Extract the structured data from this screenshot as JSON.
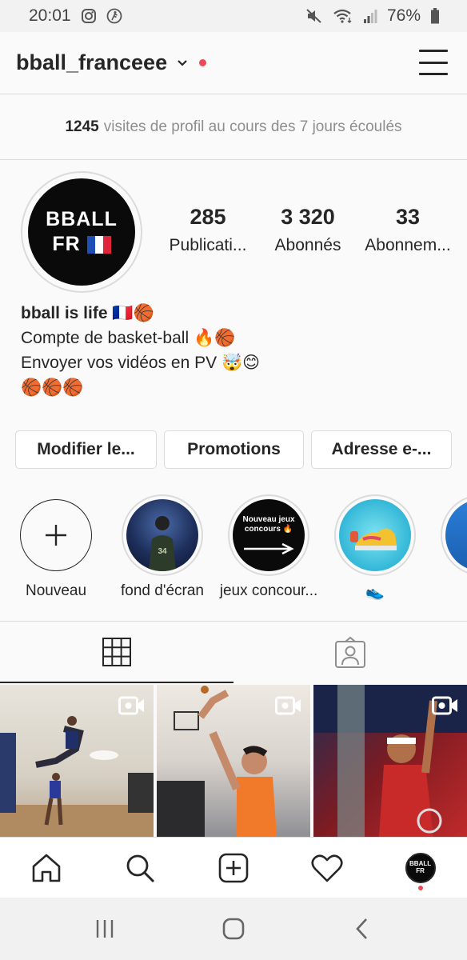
{
  "status_bar": {
    "time": "20:01",
    "battery": "76%"
  },
  "header": {
    "username": "bball_franceee"
  },
  "insights": {
    "count": "1245",
    "text": "visites de profil au cours des 7 jours écoulés"
  },
  "profile": {
    "avatar_line1": "BBALL",
    "avatar_line2": "FR",
    "stats": [
      {
        "value": "285",
        "label": "Publicati..."
      },
      {
        "value": "3 320",
        "label": "Abonnés"
      },
      {
        "value": "33",
        "label": "Abonnem..."
      }
    ],
    "bio": {
      "name": "bball is life 🇫🇷🏀",
      "line1": "Compte de basket-ball 🔥🏀",
      "line2": "Envoyer vos vidéos en PV 🤯😊",
      "line3": "🏀🏀🏀"
    }
  },
  "actions": {
    "edit": "Modifier le...",
    "promotions": "Promotions",
    "email": "Adresse e-..."
  },
  "highlights": [
    {
      "label": "Nouveau"
    },
    {
      "label": "fond d'écran"
    },
    {
      "label": "jeux concour...",
      "cover_text": "Nouveau jeux concours 🔥"
    },
    {
      "label": "👟"
    }
  ],
  "bottom_nav": {
    "avatar_text": "BBALL FR"
  },
  "colors": {
    "notification_red": "#ed4956",
    "text_primary": "#262626",
    "text_secondary": "#8e8e8e",
    "divider": "#dbdbdb"
  }
}
